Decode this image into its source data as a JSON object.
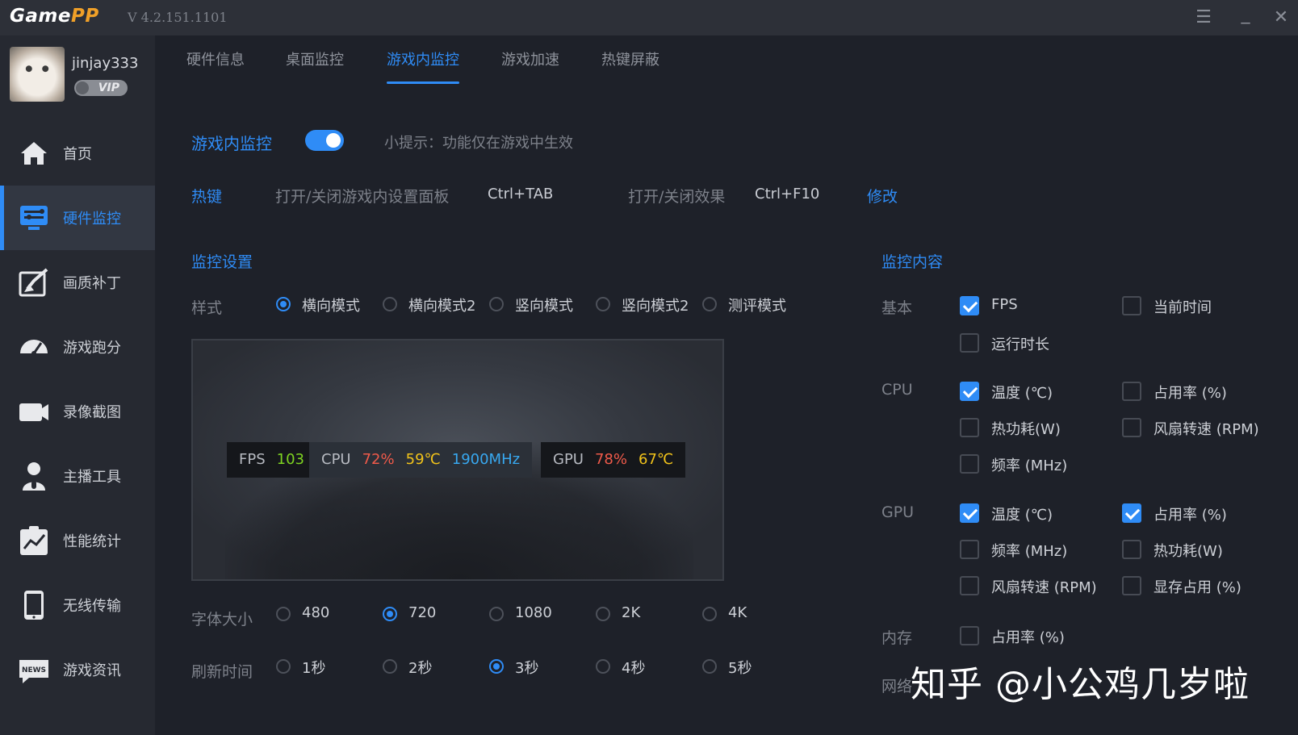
{
  "app": {
    "logo_main": "Game",
    "logo_accent": "PP",
    "version": "V 4.2.151.1101",
    "accent": "#2f8cf6"
  },
  "window_controls": {
    "menu": "☰",
    "minimize": "_",
    "close": "✕"
  },
  "user": {
    "name": "jinjay333",
    "badge": "VIP"
  },
  "sidebar": {
    "items": [
      {
        "label": "首页",
        "icon": "home-icon"
      },
      {
        "label": "硬件监控",
        "icon": "hardware-monitor-icon",
        "active": true
      },
      {
        "label": "画质补丁",
        "icon": "quality-patch-icon"
      },
      {
        "label": "游戏跑分",
        "icon": "speedometer-icon"
      },
      {
        "label": "录像截图",
        "icon": "camera-icon"
      },
      {
        "label": "主播工具",
        "icon": "streamer-icon"
      },
      {
        "label": "性能统计",
        "icon": "stats-chart-icon"
      },
      {
        "label": "无线传输",
        "icon": "phone-icon"
      },
      {
        "label": "游戏资讯",
        "icon": "news-icon"
      }
    ]
  },
  "tabs": [
    {
      "label": "硬件信息"
    },
    {
      "label": "桌面监控"
    },
    {
      "label": "游戏内监控",
      "active": true
    },
    {
      "label": "游戏加速"
    },
    {
      "label": "热键屏蔽"
    }
  ],
  "monitor": {
    "title": "游戏内监控",
    "enabled": true,
    "tip": "小提示：功能仅在游戏中生效"
  },
  "hotkeys": {
    "label": "热键",
    "panel_label": "打开/关闭游戏内设置面板",
    "panel_key": "Ctrl+TAB",
    "effect_label": "打开/关闭效果",
    "effect_key": "Ctrl+F10",
    "modify": "修改"
  },
  "settings": {
    "title": "监控设置",
    "style_label": "样式",
    "styles": [
      "横向模式",
      "横向模式2",
      "竖向模式",
      "竖向模式2",
      "测评模式"
    ],
    "style_selected": 0,
    "font_label": "字体大小",
    "fonts": [
      "480",
      "720",
      "1080",
      "2K",
      "4K"
    ],
    "font_selected": 1,
    "refresh_label": "刷新时间",
    "refresh": [
      "1秒",
      "2秒",
      "3秒",
      "4秒",
      "5秒"
    ],
    "refresh_selected": 2
  },
  "preview": {
    "fps_key": "FPS",
    "fps_val": "103",
    "cpu_key": "CPU",
    "cpu_usage": "72%",
    "cpu_temp": "59℃",
    "cpu_freq": "1900MHz",
    "gpu_key": "GPU",
    "gpu_usage": "78%",
    "gpu_temp": "67℃"
  },
  "content": {
    "title": "监控内容",
    "groups": {
      "basic": "基本",
      "cpu": "CPU",
      "gpu": "GPU",
      "mem": "内存",
      "net": "网络"
    },
    "basic": [
      {
        "label": "FPS",
        "checked": true
      },
      {
        "label": "当前时间",
        "checked": false
      },
      {
        "label": "运行时长",
        "checked": false
      }
    ],
    "cpu": [
      {
        "label": "温度 (℃)",
        "checked": true
      },
      {
        "label": "占用率 (%)",
        "checked": false
      },
      {
        "label": "热功耗(W)",
        "checked": false
      },
      {
        "label": "风扇转速 (RPM)",
        "checked": false
      },
      {
        "label": "频率 (MHz)",
        "checked": false
      }
    ],
    "gpu": [
      {
        "label": "温度 (℃)",
        "checked": true
      },
      {
        "label": "占用率 (%)",
        "checked": true
      },
      {
        "label": "频率 (MHz)",
        "checked": false
      },
      {
        "label": "热功耗(W)",
        "checked": false
      },
      {
        "label": "风扇转速 (RPM)",
        "checked": false
      },
      {
        "label": "显存占用 (%)",
        "checked": false
      }
    ],
    "mem": [
      {
        "label": "占用率 (%)",
        "checked": false
      }
    ]
  },
  "watermark": "知乎 @小公鸡几岁啦"
}
